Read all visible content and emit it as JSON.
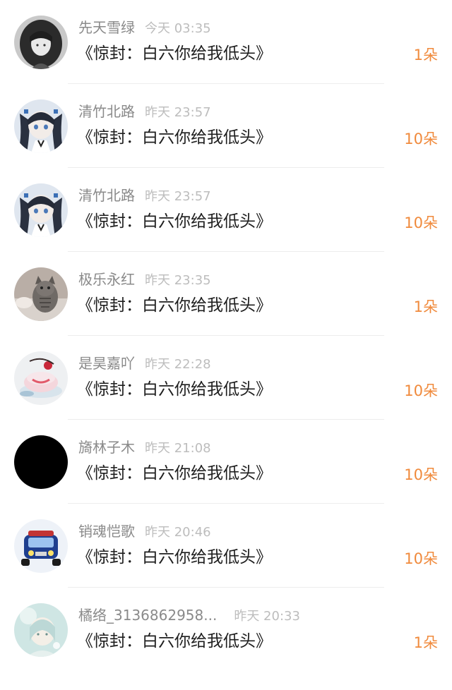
{
  "items": [
    {
      "user": "先天雪绿",
      "time": "今天 03:35",
      "title": "《惊封：白六你给我低头》",
      "count": "1朵",
      "avatar": "grayscale-anime-girl-avatar"
    },
    {
      "user": "清竹北路",
      "time": "昨天 23:57",
      "title": "《惊封：白六你给我低头》",
      "count": "10朵",
      "avatar": "anime-girl-twintails-avatar"
    },
    {
      "user": "清竹北路",
      "time": "昨天 23:57",
      "title": "《惊封：白六你给我低头》",
      "count": "10朵",
      "avatar": "anime-girl-twintails-avatar"
    },
    {
      "user": "极乐永红",
      "time": "昨天 23:35",
      "title": "《惊封：白六你给我低头》",
      "count": "1朵",
      "avatar": "cat-photo-avatar"
    },
    {
      "user": "是昊嘉吖",
      "time": "昨天 22:28",
      "title": "《惊封：白六你给我低头》",
      "count": "10朵",
      "avatar": "dessert-photo-avatar"
    },
    {
      "user": "旖林子木",
      "time": "昨天 21:08",
      "title": "《惊封：白六你给我低头》",
      "count": "10朵",
      "avatar": "black-avatar"
    },
    {
      "user": "销魂恺歌",
      "time": "昨天 20:46",
      "title": "《惊封：白六你给我低头》",
      "count": "10朵",
      "avatar": "blue-car-avatar"
    },
    {
      "user": "橘络_3136862958...",
      "time": "昨天 20:33",
      "title": "《惊封：白六你给我低头》",
      "count": "1朵",
      "avatar": "pastel-anime-avatar"
    }
  ]
}
